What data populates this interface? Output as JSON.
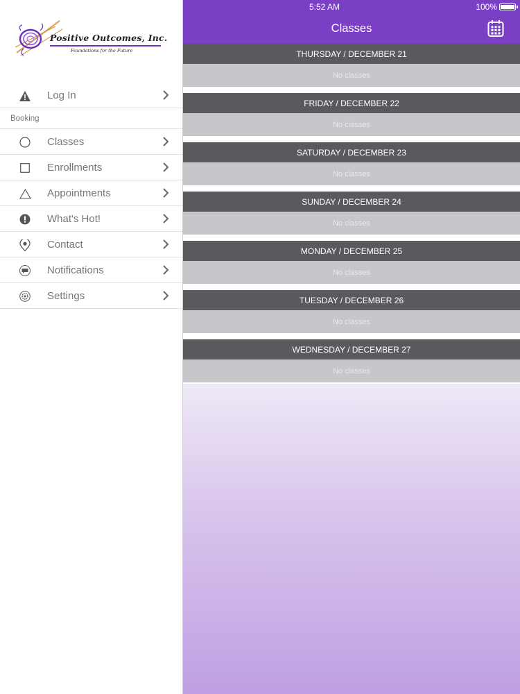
{
  "status_bar": {
    "time": "5:52 AM",
    "battery": "100%"
  },
  "logo": {
    "title": "Positive Outcomes, Inc.",
    "tagline": "Foundations for the Future"
  },
  "sidebar": {
    "login": {
      "label": "Log In",
      "icon": "warning-icon"
    },
    "section": "Booking",
    "items": [
      {
        "label": "Classes",
        "icon": "circle-icon"
      },
      {
        "label": "Enrollments",
        "icon": "square-icon"
      },
      {
        "label": "Appointments",
        "icon": "triangle-icon"
      },
      {
        "label": "What's Hot!",
        "icon": "exclamation-icon"
      },
      {
        "label": "Contact",
        "icon": "location-pin-icon"
      },
      {
        "label": "Notifications",
        "icon": "chat-bubble-icon"
      },
      {
        "label": "Settings",
        "icon": "gear-icon"
      }
    ]
  },
  "header": {
    "title": "Classes",
    "action_icon": "calendar-icon"
  },
  "days": [
    {
      "label": "THURSDAY / DECEMBER 21",
      "body": "No classes"
    },
    {
      "label": "FRIDAY / DECEMBER 22",
      "body": "No classes"
    },
    {
      "label": "SATURDAY / DECEMBER 23",
      "body": "No classes"
    },
    {
      "label": "SUNDAY / DECEMBER 24",
      "body": "No classes"
    },
    {
      "label": "MONDAY / DECEMBER 25",
      "body": "No classes"
    },
    {
      "label": "TUESDAY / DECEMBER 26",
      "body": "No classes"
    },
    {
      "label": "WEDNESDAY / DECEMBER 27",
      "body": "No classes"
    }
  ],
  "colors": {
    "accent": "#7b3fc6",
    "day_header": "#5a5a5e",
    "day_body": "#c7c6cb"
  }
}
